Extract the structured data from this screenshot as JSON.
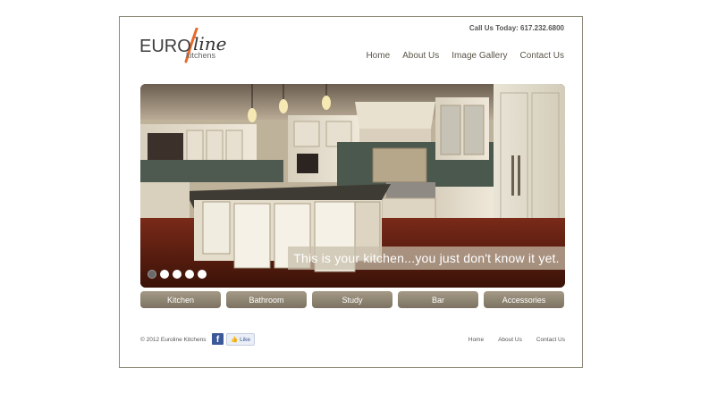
{
  "header": {
    "logo": {
      "euro": "EURO",
      "line": "line",
      "kitchens": "kitchens"
    },
    "call_us": "Call Us Today: 617.232.6800",
    "nav": [
      "Home",
      "About Us",
      "Image Gallery",
      "Contact Us"
    ]
  },
  "hero": {
    "caption": "This is your kitchen...you just don't know it yet.",
    "slide_count": 5,
    "active_slide": 1
  },
  "categories": [
    "Kitchen",
    "Bathroom",
    "Study",
    "Bar",
    "Accessories"
  ],
  "footer": {
    "copyright": "© 2012 Euroline Kitchens",
    "like_label": "Like",
    "nav": [
      "Home",
      "About Us",
      "Contact Us"
    ]
  },
  "colors": {
    "accent": "#e86a2a",
    "button": "#8c8271",
    "border": "#8d8a7a"
  }
}
